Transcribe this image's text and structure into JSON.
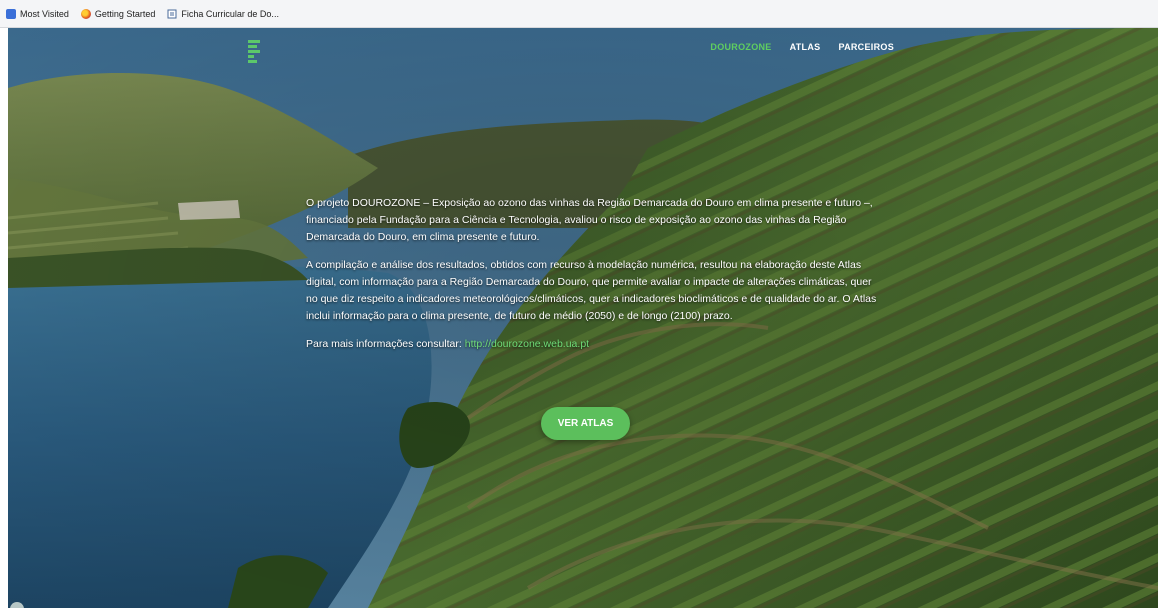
{
  "bookmarks": [
    {
      "label": "Most Visited",
      "icon": "bookmark-star-icon"
    },
    {
      "label": "Getting Started",
      "icon": "firefox-icon"
    },
    {
      "label": "Ficha Curricular de Do...",
      "icon": "document-icon"
    }
  ],
  "brand": {
    "accent_color": "#5cbf5c",
    "logo": "dourozone-logo"
  },
  "nav": {
    "items": [
      {
        "label": "DOUROZONE",
        "active": true
      },
      {
        "label": "ATLAS",
        "active": false
      },
      {
        "label": "PARCEIROS",
        "active": false
      }
    ]
  },
  "hero": {
    "paragraph_1": "O projeto DOUROZONE – Exposição ao ozono das vinhas da Região Demarcada do Douro em clima presente e futuro –, financiado pela Fundação para a Ciência e Tecnologia, avaliou o risco de exposição ao ozono das vinhas da Região Demarcada do Douro, em clima presente e futuro.",
    "paragraph_2": "A compilação e análise dos resultados, obtidos com recurso à modelação numérica, resultou na elaboração deste Atlas digital, com informação para a Região Demarcada do Douro, que permite avaliar o impacte de alterações climáticas, quer no que diz respeito a indicadores meteorológicos/climáticos, quer a indicadores bioclimáticos e de qualidade do ar. O Atlas inclui informação para o clima presente, de futuro de médio (2050) e de longo (2100) prazo.",
    "info_prefix": "Para mais informações consultar: ",
    "info_link": "http://dourozone.web.ua.pt",
    "cta_label": "VER ATLAS"
  }
}
